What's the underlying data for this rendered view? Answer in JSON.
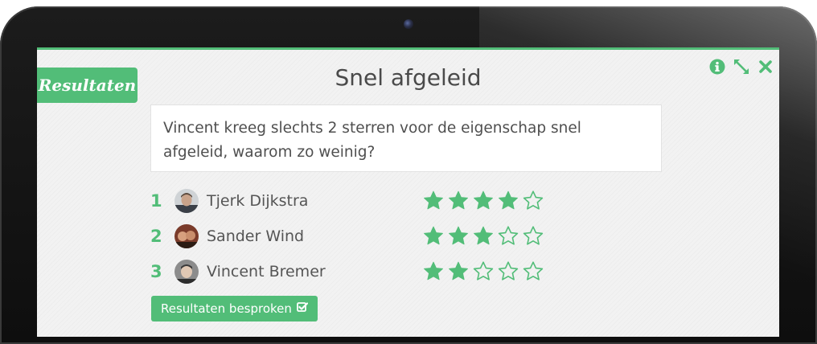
{
  "panel": {
    "tag_label": "Resultaten",
    "title": "Snel afgeleid",
    "window_icons": [
      "info-icon",
      "expand-icon",
      "close-icon"
    ],
    "accent_color": "#52bd78"
  },
  "question": {
    "text": "Vincent kreeg slechts 2 sterren voor de eigenschap snel afgeleid, waarom zo weinig?"
  },
  "results": [
    {
      "rank": "1",
      "name": "Tjerk Dijkstra",
      "stars": 4,
      "max_stars": 5
    },
    {
      "rank": "2",
      "name": "Sander Wind",
      "stars": 3,
      "max_stars": 5
    },
    {
      "rank": "3",
      "name": "Vincent Bremer",
      "stars": 2,
      "max_stars": 5
    }
  ],
  "footer": {
    "discuss_label": "Resultaten besproken",
    "discuss_icon": "check-square-icon"
  }
}
